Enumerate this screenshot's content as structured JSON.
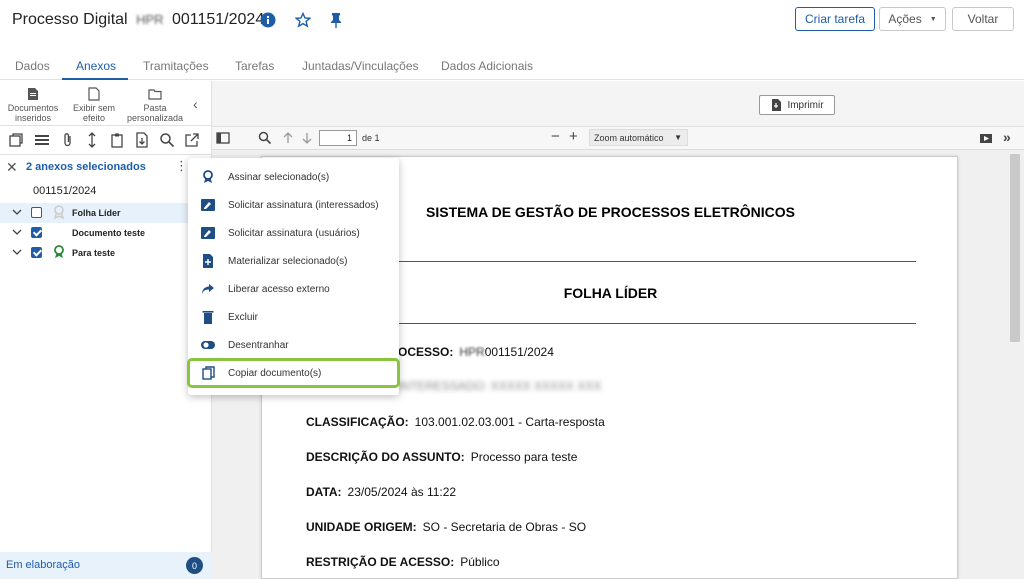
{
  "header": {
    "title_prefix": "Processo Digital",
    "title_code": "HPR",
    "title_number": "001151/2024",
    "buttons": {
      "create_task": "Criar tarefa",
      "actions": "Ações",
      "back": "Voltar"
    }
  },
  "tabs": [
    "Dados",
    "Anexos",
    "Tramitações",
    "Tarefas",
    "Juntadas/Vinculações",
    "Dados Adicionais"
  ],
  "left_toolbar": {
    "docs_inserted": [
      "Documentos",
      "inseridos"
    ],
    "show_no_effect": [
      "Exibir sem",
      "efeito"
    ],
    "custom_folder": [
      "Pasta",
      "personalizada"
    ]
  },
  "selection": {
    "text": "2 anexos selecionados"
  },
  "tree": {
    "process": "001151/2024",
    "items": [
      {
        "label": "Folha Líder",
        "checked": false
      },
      {
        "label": "Documento teste",
        "checked": true
      },
      {
        "label": "Para teste",
        "checked": true
      }
    ]
  },
  "status": {
    "label": "Em elaboração",
    "count": "0"
  },
  "viewer": {
    "print_label": "Imprimir",
    "page_current": "1",
    "page_total": "de 1",
    "zoom": "Zoom automático"
  },
  "document": {
    "header": "SISTEMA DE GESTÃO DE PROCESSOS ELETRÔNICOS",
    "title": "FOLHA LÍDER",
    "process_label_visible": "OCESSO:",
    "process_value": "001151/2024",
    "process_code": "HPR",
    "blurred_line": "INTERESSADO: XXXXX XXXXX XXX",
    "classification_label": "CLASSIFICAÇÃO:",
    "classification_value": "103.001.02.03.001 - Carta-resposta",
    "subject_label": "DESCRIÇÃO DO ASSUNTO:",
    "subject_value": "Processo para teste",
    "date_label": "DATA:",
    "date_value": "23/05/2024 às 11:22",
    "origin_label": "UNIDADE ORIGEM:",
    "origin_value": "SO - Secretaria de Obras - SO",
    "restriction_label": "RESTRIÇÃO DE ACESSO:",
    "restriction_value": "Público"
  },
  "menu": [
    {
      "label": "Assinar selecionado(s)",
      "icon": "ribbon-icon"
    },
    {
      "label": "Solicitar assinatura (interessados)",
      "icon": "signature-icon"
    },
    {
      "label": "Solicitar assinatura (usuários)",
      "icon": "signature-icon"
    },
    {
      "label": "Materializar selecionado(s)",
      "icon": "file-add-icon"
    },
    {
      "label": "Liberar acesso externo",
      "icon": "share-icon"
    },
    {
      "label": "Excluir",
      "icon": "trash-icon"
    },
    {
      "label": "Desentranhar",
      "icon": "toggle-icon"
    },
    {
      "label": "Copiar documento(s)",
      "icon": "copy-icon"
    }
  ],
  "colors": {
    "accent": "#1f5da8",
    "highlight": "#8ac43f",
    "selection_bg": "#e6f1fb"
  }
}
